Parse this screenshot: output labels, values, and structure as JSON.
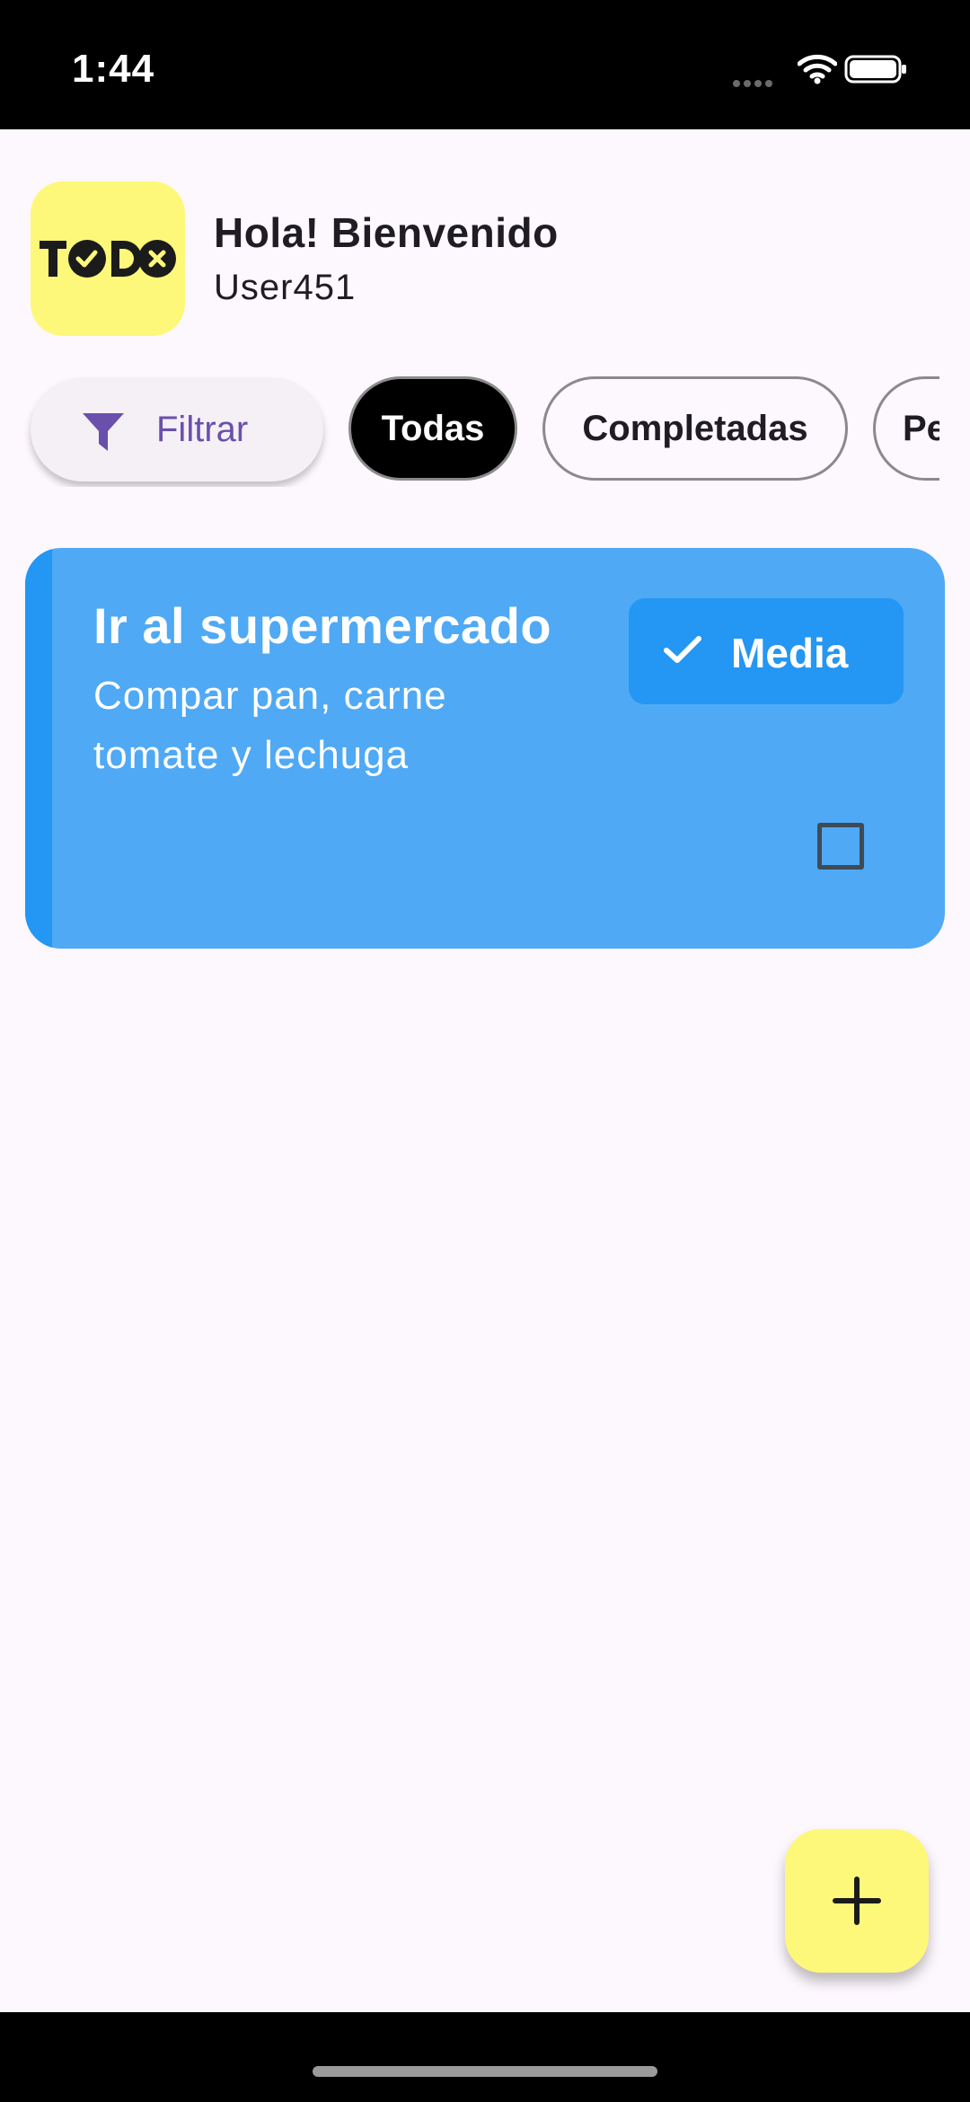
{
  "status_bar": {
    "time": "1:44",
    "icons": [
      "signal-dots-icon",
      "wifi-icon",
      "battery-icon"
    ]
  },
  "header": {
    "logo_text": "TODO",
    "greeting": "Hola! Bienvenido",
    "username": "User451"
  },
  "filters": {
    "filter_button_label": "Filtrar",
    "filter_icon": "funnel-icon",
    "chips": [
      {
        "label": "Todas",
        "selected": true
      },
      {
        "label": "Completadas",
        "selected": false
      },
      {
        "label": "Pe",
        "selected": false
      }
    ]
  },
  "tasks": [
    {
      "title": "Ir al supermercado",
      "description": "Compar pan, carne tomate y lechuga",
      "priority": "Media",
      "completed": false
    }
  ],
  "fab": {
    "icon": "plus-icon"
  },
  "colors": {
    "background": "#FDF7FE",
    "accent_yellow": "#FDF879",
    "task_card": "#4FA9F5",
    "task_accent": "#2496F3",
    "filter_text": "#6A4FAD"
  }
}
